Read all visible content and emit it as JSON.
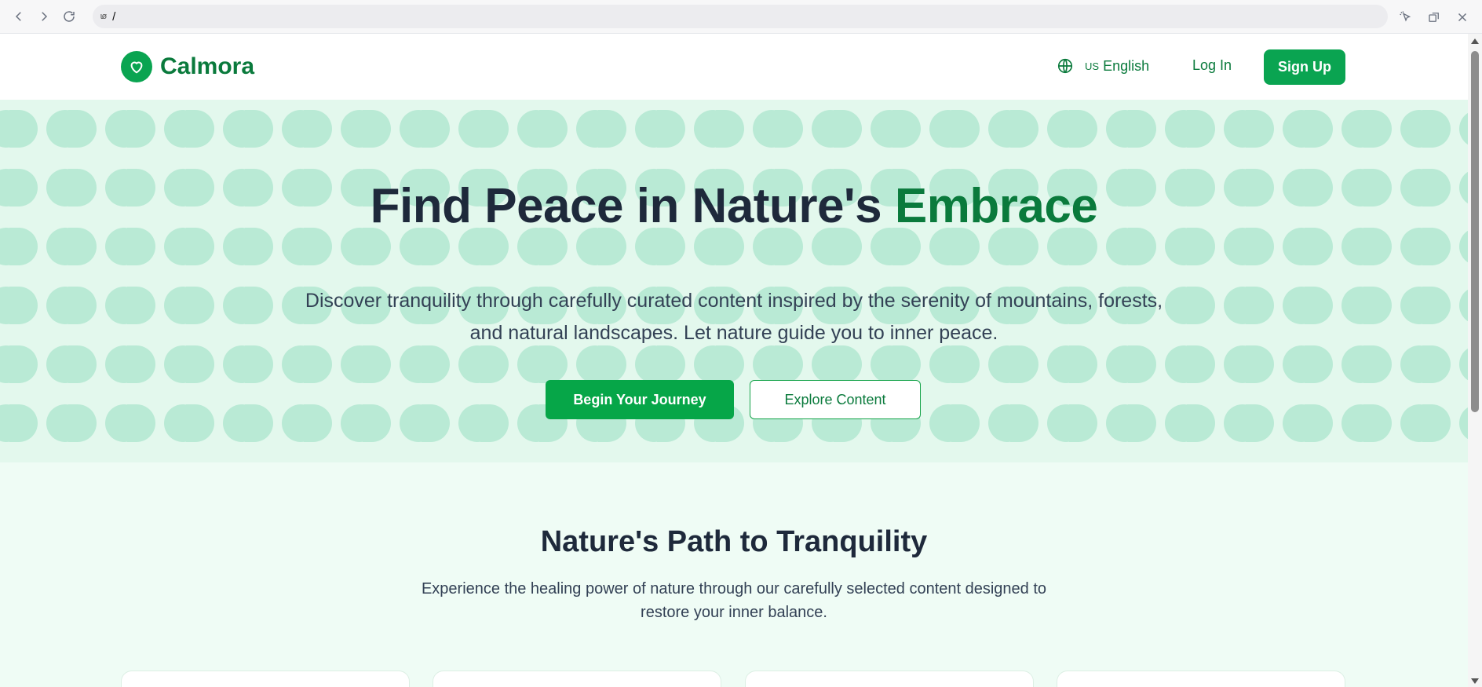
{
  "browser": {
    "url": "/",
    "site_icon": "ɩø"
  },
  "header": {
    "brand": "Calmora",
    "language_flag": "US",
    "language": "English",
    "login": "Log In",
    "signup": "Sign Up"
  },
  "hero": {
    "title_main": "Find Peace in Nature's ",
    "title_accent": "Embrace",
    "subtitle": "Discover tranquility through carefully curated content inspired by the serenity of mountains, forests, and natural landscapes. Let nature guide you to inner peace.",
    "primary_cta": "Begin Your Journey",
    "secondary_cta": "Explore Content"
  },
  "section": {
    "title": "Nature's Path to Tranquility",
    "subtitle": "Experience the healing power of nature through our carefully selected content designed to restore your inner balance."
  },
  "colors": {
    "brand_green": "#0aa451",
    "brand_text": "#0a7a3c",
    "hero_bg": "#e3f8ed",
    "pattern": "#b9ead5"
  }
}
